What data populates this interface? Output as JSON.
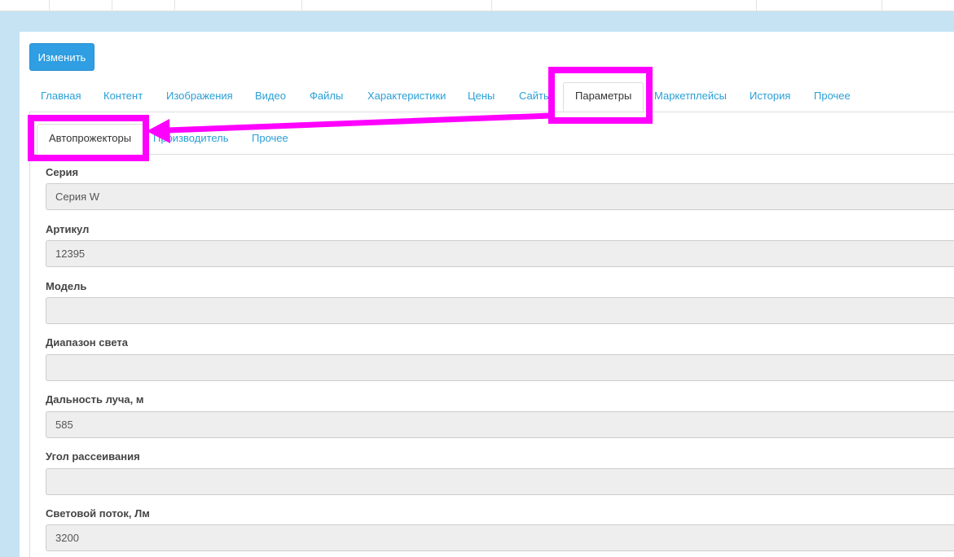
{
  "toolbar": {
    "edit_label": "Изменить"
  },
  "main_tabs": [
    {
      "label": "Главная"
    },
    {
      "label": "Контент"
    },
    {
      "label": "Изображения"
    },
    {
      "label": "Видео"
    },
    {
      "label": "Файлы"
    },
    {
      "label": "Характеристики"
    },
    {
      "label": "Цены"
    },
    {
      "label": "Сайты"
    },
    {
      "label": "Параметры",
      "active": true
    },
    {
      "label": "Маркетплейсы"
    },
    {
      "label": "История"
    },
    {
      "label": "Прочее"
    }
  ],
  "sub_tabs": [
    {
      "label": "Автопрожекторы",
      "active": true
    },
    {
      "label": "Производитель"
    },
    {
      "label": "Прочее"
    }
  ],
  "fields": [
    {
      "label": "Серия",
      "value": "Серия W"
    },
    {
      "label": "Артикул",
      "value": "12395"
    },
    {
      "label": "Модель",
      "value": ""
    },
    {
      "label": "Диапазон света",
      "value": ""
    },
    {
      "label": "Дальность луча, м",
      "value": "585"
    },
    {
      "label": "Угол рассеивания",
      "value": ""
    },
    {
      "label": "Световой поток, Лм",
      "value": "3200"
    }
  ],
  "colors": {
    "accent": "#2a9fd6",
    "button": "#2f9ee2",
    "highlight": "#ff00ff",
    "background": "#c5e3f3"
  }
}
